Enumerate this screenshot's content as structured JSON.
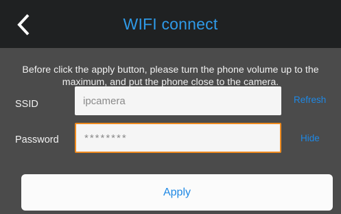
{
  "header": {
    "title": "WIFI connect",
    "back_icon": "chevron-left-icon"
  },
  "notice": {
    "text": "Before click the apply button, please turn the phone volume up to the maximum, and put the phone close to the camera."
  },
  "form": {
    "ssid": {
      "label": "SSID",
      "value": "ipcamera",
      "action": "Refresh"
    },
    "password": {
      "label": "Password",
      "value": "********",
      "action": "Hide"
    },
    "apply_label": "Apply"
  },
  "colors": {
    "title_bar": "#1f2122",
    "content_bg": "#4b4b4b",
    "accent_blue": "#1e88e5",
    "focus_orange": "#ef8a1e"
  }
}
